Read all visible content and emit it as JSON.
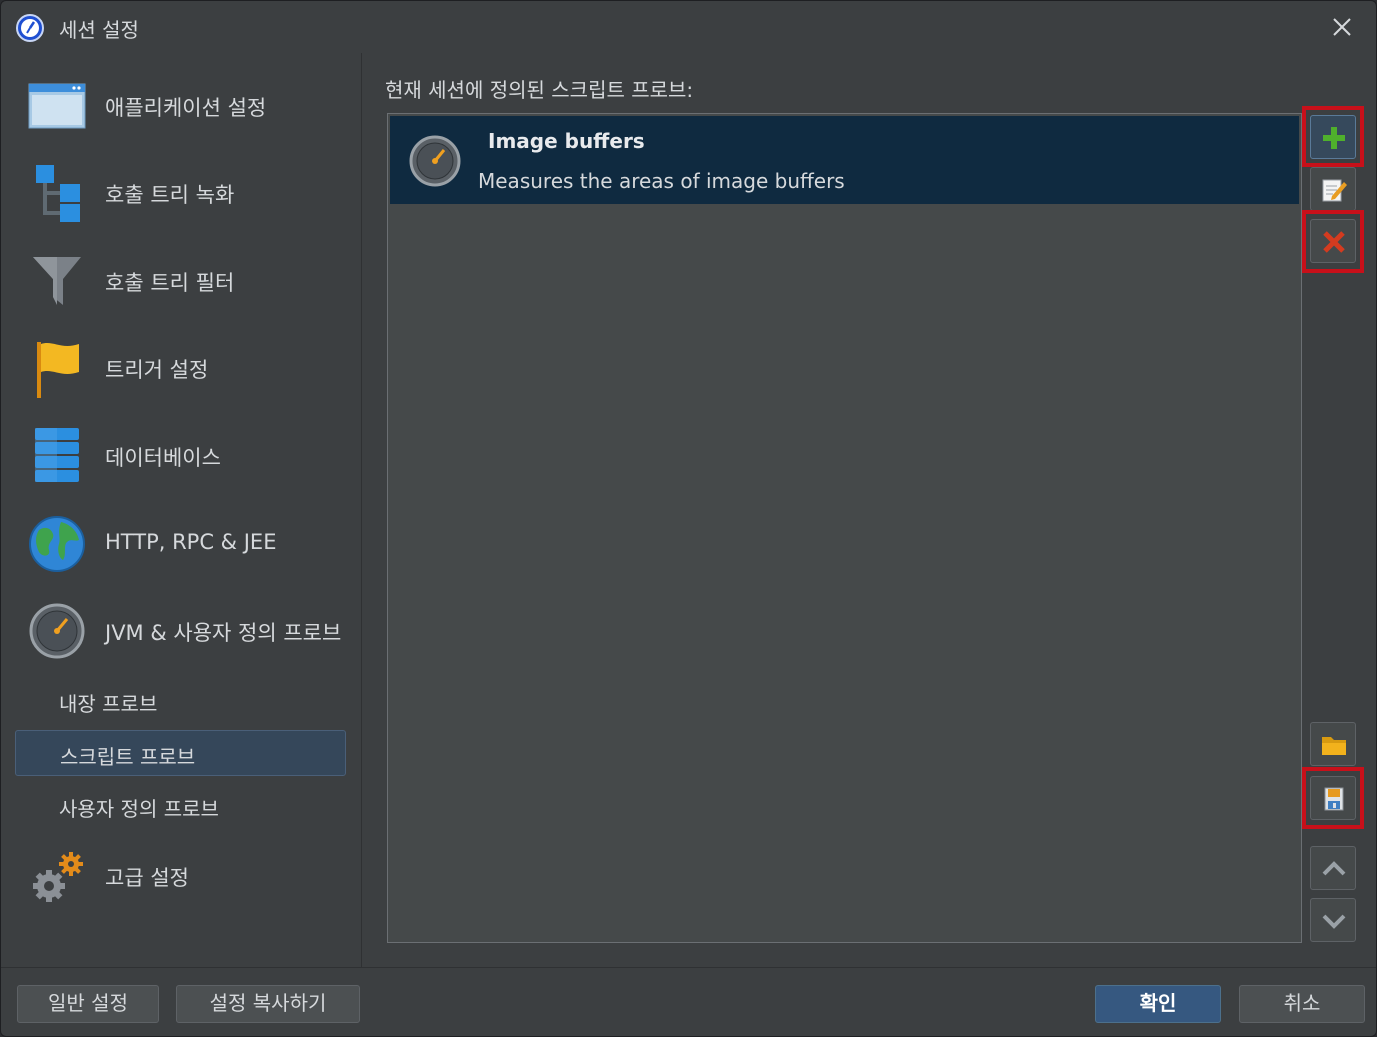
{
  "window": {
    "title": "세션 설정"
  },
  "icons": {
    "app": "stopwatch-icon",
    "close": "close-icon"
  },
  "sidebar": {
    "items": [
      {
        "label": "애플리케이션 설정",
        "icon": "window-icon"
      },
      {
        "label": "호출 트리 녹화",
        "icon": "call-tree-icon"
      },
      {
        "label": "호출 트리 필터",
        "icon": "funnel-icon"
      },
      {
        "label": "트리거 설정",
        "icon": "flag-icon"
      },
      {
        "label": "데이터베이스",
        "icon": "database-icon"
      },
      {
        "label": "HTTP, RPC & JEE",
        "icon": "globe-icon"
      },
      {
        "label": "JVM & 사용자 정의 프로브",
        "icon": "gauge-icon"
      },
      {
        "label": "고급 설정",
        "icon": "gears-icon"
      }
    ],
    "sub_items": [
      {
        "label": "내장 프로브",
        "selected": false
      },
      {
        "label": "스크립트 프로브",
        "selected": true
      },
      {
        "label": "사용자 정의 프로브",
        "selected": false
      }
    ]
  },
  "main": {
    "label": "현재 세션에 정의된 스크립트 프로브:",
    "probes": [
      {
        "title": "Image buffers",
        "description": "Measures the areas of image buffers",
        "icon": "gauge-icon"
      }
    ]
  },
  "toolbar": {
    "buttons": [
      "add-icon",
      "edit-icon",
      "delete-icon",
      "folder-icon",
      "save-icon",
      "move-up-icon",
      "move-down-icon"
    ],
    "highlighted": [
      "add-icon",
      "delete-icon",
      "save-icon"
    ]
  },
  "footer": {
    "general_settings": "일반 설정",
    "copy_settings": "설정 복사하기",
    "ok": "확인",
    "cancel": "취소"
  },
  "colors": {
    "background": "#3c3f41",
    "selection": "#0f2a40",
    "accent": "#365880",
    "highlight": "#c8101a"
  }
}
